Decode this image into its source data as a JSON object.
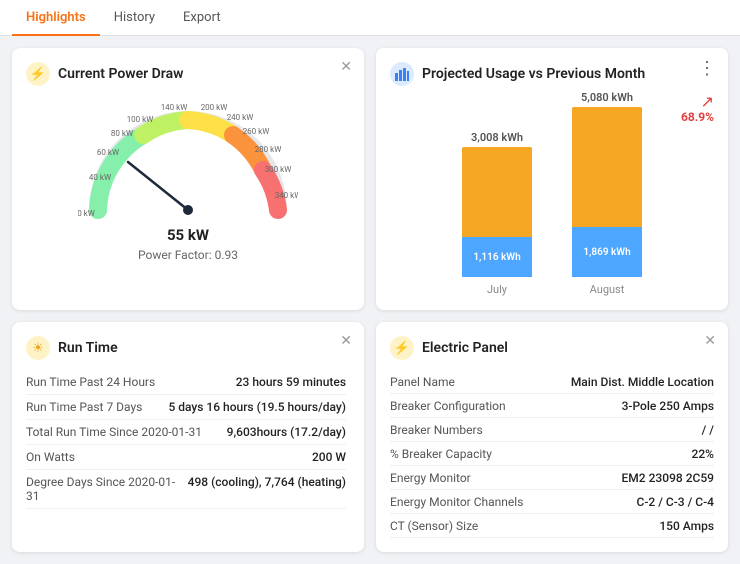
{
  "nav": {
    "tabs": [
      {
        "label": "Highlights",
        "active": true
      },
      {
        "label": "History",
        "active": false
      },
      {
        "label": "Export",
        "active": false
      }
    ]
  },
  "currentPowerDraw": {
    "title": "Current Power Draw",
    "icon": "⚡",
    "gaugeValue": "55 kW",
    "powerFactor": "Power Factor: 0.93",
    "labels": [
      "0 kW",
      "40 kW",
      "60 kW",
      "80 kW",
      "100 kW",
      "140 kW",
      "200 kW",
      "240 kW",
      "260 kW",
      "280 kW",
      "300 kW",
      "340 kW"
    ]
  },
  "projectedUsage": {
    "title": "Projected Usage vs Previous Month",
    "icon": "📊",
    "trend": "68.9%",
    "bars": [
      {
        "month": "July",
        "topLabel": "3,008 kWh",
        "orangeHeight": 90,
        "blueHeight": 40,
        "blueLabel": "1,116 kWh"
      },
      {
        "month": "August",
        "topLabel": "5,080 kWh",
        "orangeHeight": 120,
        "blueHeight": 50,
        "blueLabel": "1,869 kWh"
      }
    ]
  },
  "runTime": {
    "title": "Run Time",
    "icon": "⚙",
    "rows": [
      {
        "label": "Run Time Past 24 Hours",
        "value": "23 hours 59 minutes"
      },
      {
        "label": "Run Time Past 7 Days",
        "value": "5 days 16 hours (19.5 hours/day)"
      },
      {
        "label": "Total Run Time Since 2020-01-31",
        "value": "9,603hours (17.2/day)"
      },
      {
        "label": "On Watts",
        "value": "200 W"
      },
      {
        "label": "Degree Days Since 2020-01-31",
        "value": "498 (cooling), 7,764 (heating)"
      }
    ]
  },
  "electricPanel": {
    "title": "Electric Panel",
    "icon": "⚡",
    "rows": [
      {
        "label": "Panel Name",
        "value": "Main Dist. Middle Location"
      },
      {
        "label": "Breaker Configuration",
        "value": "3-Pole 250 Amps"
      },
      {
        "label": "Breaker Numbers",
        "value": "/ /"
      },
      {
        "label": "% Breaker Capacity",
        "value": "22%"
      },
      {
        "label": "Energy Monitor",
        "value": "EM2 23098 2C59"
      },
      {
        "label": "Energy Monitor Channels",
        "value": "C-2 / C-3 / C-4"
      },
      {
        "label": "CT (Sensor) Size",
        "value": "150 Amps"
      }
    ]
  }
}
